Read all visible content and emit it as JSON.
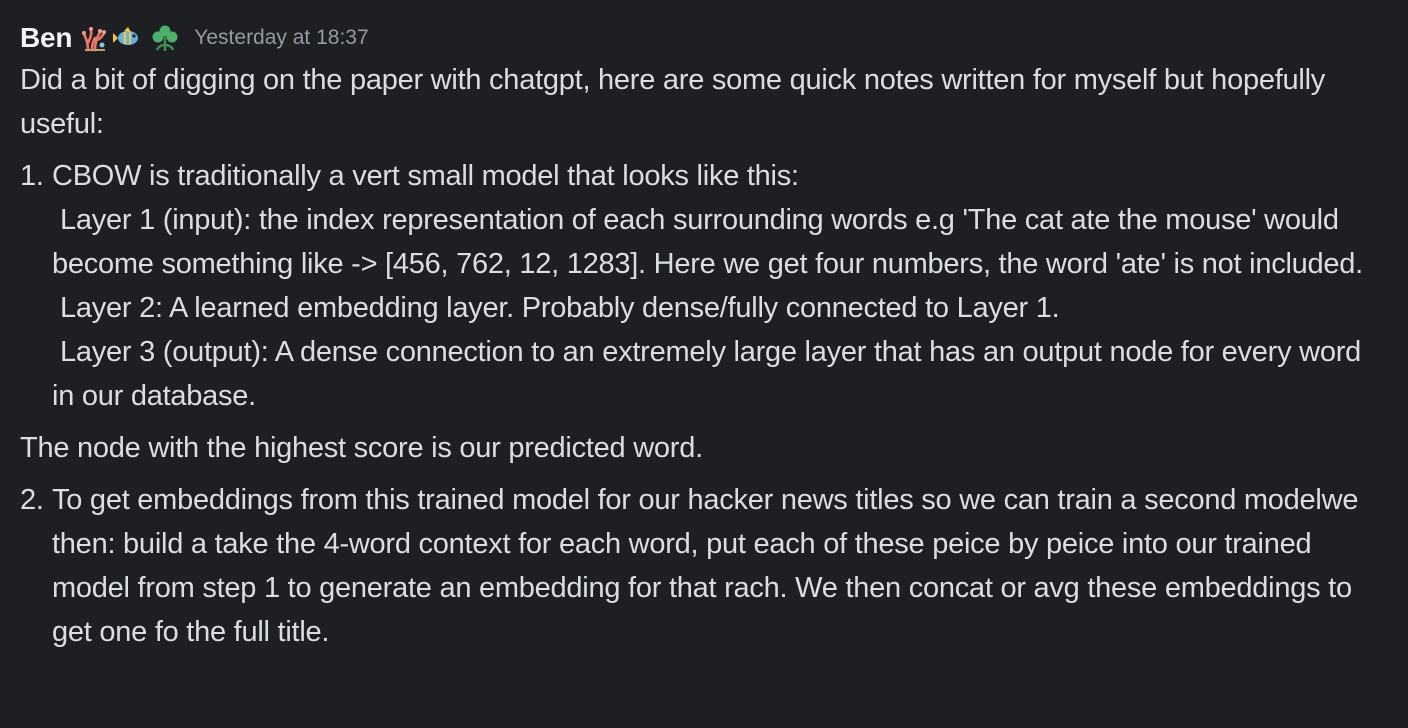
{
  "message": {
    "author": "Ben",
    "tags": [
      "coral-emoji",
      "tropical-fish-emoji",
      "clover-emoji"
    ],
    "timestamp": "Yesterday at 18:37",
    "intro": "Did a bit of digging on the paper with chatgpt, here are some quick notes written for myself but hopefully useful:",
    "item1": {
      "marker": "1.",
      "heading": "CBOW is traditionally a vert small model that looks like this:",
      "layers": [
        "Layer 1 (input): the index representation of each surrounding words e.g 'The cat ate the mouse' would become something like -> [456, 762, 12, 1283]. Here we get four numbers, the word 'ate' is not included.",
        "Layer 2: A learned embedding layer. Probably dense/fully connected to Layer 1.",
        "Layer 3 (output): A dense connection to an extremely large layer that has an output node for every word in our database."
      ]
    },
    "between": "The node with the highest score is our predicted word.",
    "item2": {
      "marker": "2.",
      "text": "To get embeddings from this trained model for our hacker news titles so we can train a second modelwe then: build a take the 4-word context for each word, put each of these peice by peice into our trained model from step 1 to generate an embedding for that rach. We then concat or avg these embeddings to get one fo the full title."
    }
  }
}
